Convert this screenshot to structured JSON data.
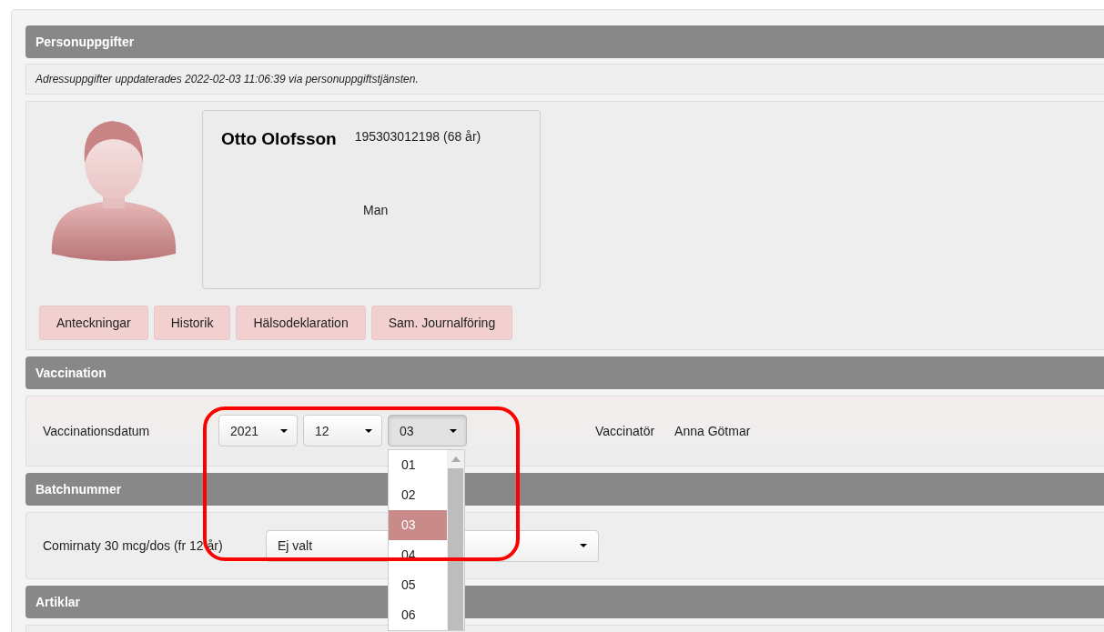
{
  "personal": {
    "title": "Personuppgifter",
    "notice": "Adressuppgifter uppdaterades 2022-02-03 11:06:39 via personuppgiftstjänsten.",
    "name": "Otto Olofsson",
    "id": "195303012198 (68 år)",
    "gender": "Man",
    "buttons": [
      "Anteckningar",
      "Historik",
      "Hälsodeklaration",
      "Sam. Journalföring"
    ]
  },
  "vaccination": {
    "title": "Vaccination",
    "date_label": "Vaccinationsdatum",
    "selects": [
      {
        "value": "2021",
        "open": false
      },
      {
        "value": "12",
        "open": false
      },
      {
        "value": "03",
        "open": true
      }
    ],
    "options": [
      {
        "label": "01",
        "selected": false
      },
      {
        "label": "02",
        "selected": false
      },
      {
        "label": "03",
        "selected": true
      },
      {
        "label": "04",
        "selected": false
      },
      {
        "label": "05",
        "selected": false
      },
      {
        "label": "06",
        "selected": false
      }
    ],
    "vaccinator_label": "Vaccinatör",
    "vaccinator": "Anna Götmar"
  },
  "batch": {
    "title": "Batchnummer",
    "label": "Comirnaty 30 mcg/dos (fr 12 år)",
    "value": "Ej valt"
  },
  "articles": {
    "title": "Artiklar"
  }
}
